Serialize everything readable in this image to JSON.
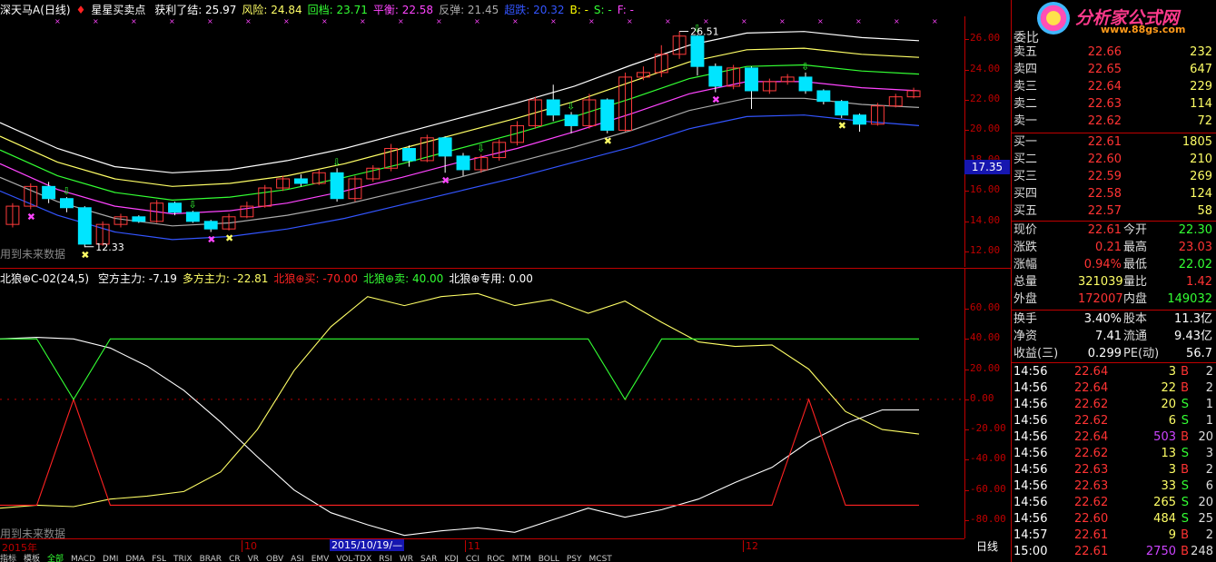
{
  "legend_top": {
    "name": "深天马A(日线)",
    "indicator": "星星买卖点",
    "items": [
      {
        "label": "获利了结: ",
        "value": "25.97",
        "color": "#ffffff"
      },
      {
        "label": "风险: ",
        "value": "24.84",
        "color": "#ffff66"
      },
      {
        "label": "回档: ",
        "value": "23.71",
        "color": "#33ff33"
      },
      {
        "label": "平衡: ",
        "value": "22.58",
        "color": "#ff44ff"
      },
      {
        "label": "反弹: ",
        "value": "21.45",
        "color": "#aaaaaa"
      },
      {
        "label": "超跌: ",
        "value": "20.32",
        "color": "#3355ff"
      },
      {
        "label": "B: ",
        "value": "-",
        "color": "#ffff00"
      },
      {
        "label": "S: ",
        "value": "-",
        "color": "#33ff33"
      },
      {
        "label": "F: ",
        "value": "-",
        "color": "#ff44ff"
      }
    ]
  },
  "legend_sub": {
    "name": "北狼⊕C-02(24,5)",
    "items": [
      {
        "label": "空方主力: ",
        "value": "-7.19",
        "color": "#ffffff"
      },
      {
        "label": "多方主力: ",
        "value": "-22.81",
        "color": "#ffff66"
      },
      {
        "label": "北狼⊕买: ",
        "value": "-70.00",
        "color": "#ff2222"
      },
      {
        "label": "北狼⊕卖: ",
        "value": "40.00",
        "color": "#33ff33"
      },
      {
        "label": "北狼⊕专用: ",
        "value": "0.00",
        "color": "#ffffff"
      }
    ]
  },
  "notes": {
    "future_top": "用到未来数据",
    "future_bottom": "用到未来数据"
  },
  "price_labels": {
    "high": "26.51",
    "low": "12.33"
  },
  "main_axis": {
    "ticks": [
      "26.00",
      "24.00",
      "22.00",
      "20.00",
      "18.00",
      "16.00",
      "14.00",
      "12.00"
    ],
    "current": "17.35"
  },
  "sub_axis": {
    "ticks": [
      "60.00",
      "40.00",
      "20.00",
      "0.00",
      "-20.00",
      "-40.00",
      "-60.00",
      "-80.00"
    ]
  },
  "date_axis": {
    "year": "2015年",
    "months": [
      "10",
      "11",
      "12"
    ],
    "cursor": "2015/10/19/—",
    "period": "日线"
  },
  "tabs": [
    "指标",
    "模板",
    "全部",
    "MACD",
    "DMI",
    "DMA",
    "FSL",
    "TRIX",
    "BRAR",
    "CR",
    "VR",
    "OBV",
    "ASI",
    "EMV",
    "VOL-TDX",
    "RSI",
    "WR",
    "SAR",
    "KDJ",
    "CCI",
    "ROC",
    "MTM",
    "BOLL",
    "PSY",
    "MCST"
  ],
  "logo": {
    "name": "分析家公式网",
    "url": "www.88gs.com"
  },
  "order_book": {
    "header": "委比",
    "sells": [
      {
        "label": "卖五",
        "price": "22.66",
        "vol": "232"
      },
      {
        "label": "卖四",
        "price": "22.65",
        "vol": "647"
      },
      {
        "label": "卖三",
        "price": "22.64",
        "vol": "229"
      },
      {
        "label": "卖二",
        "price": "22.63",
        "vol": "114"
      },
      {
        "label": "卖一",
        "price": "22.62",
        "vol": "72"
      }
    ],
    "buys": [
      {
        "label": "买一",
        "price": "22.61",
        "vol": "1805"
      },
      {
        "label": "买二",
        "price": "22.60",
        "vol": "210"
      },
      {
        "label": "买三",
        "price": "22.59",
        "vol": "269"
      },
      {
        "label": "买四",
        "price": "22.58",
        "vol": "124"
      },
      {
        "label": "买五",
        "price": "22.57",
        "vol": "58"
      }
    ]
  },
  "quote": [
    {
      "l1": "现价",
      "v1": "22.61",
      "c1": "#ff3333",
      "l2": "今开",
      "v2": "22.30",
      "c2": "#33ff33"
    },
    {
      "l1": "涨跌",
      "v1": "0.21",
      "c1": "#ff3333",
      "l2": "最高",
      "v2": "23.03",
      "c2": "#ff3333"
    },
    {
      "l1": "涨幅",
      "v1": "0.94%",
      "c1": "#ff3333",
      "l2": "最低",
      "v2": "22.02",
      "c2": "#33ff33"
    },
    {
      "l1": "总量",
      "v1": "321039",
      "c1": "#ffff66",
      "l2": "量比",
      "v2": "1.42",
      "c2": "#ff3333"
    },
    {
      "l1": "外盘",
      "v1": "172007",
      "c1": "#ff3333",
      "l2": "内盘",
      "v2": "149032",
      "c2": "#33ff33"
    }
  ],
  "stats": [
    {
      "l1": "换手",
      "v1": "3.40%",
      "l2": "股本",
      "v2": "11.3亿"
    },
    {
      "l1": "净资",
      "v1": "7.41",
      "l2": "流通",
      "v2": "9.43亿"
    },
    {
      "l1": "收益(三)",
      "v1": "0.299",
      "l2": "PE(动)",
      "v2": "56.7"
    }
  ],
  "ticks": [
    {
      "time": "14:56",
      "price": "22.64",
      "vol": "3",
      "bs": "B",
      "n": "2",
      "vc": "#ffff66"
    },
    {
      "time": "14:56",
      "price": "22.64",
      "vol": "22",
      "bs": "B",
      "n": "2",
      "vc": "#ffff66"
    },
    {
      "time": "14:56",
      "price": "22.62",
      "vol": "20",
      "bs": "S",
      "n": "1",
      "vc": "#ffff66"
    },
    {
      "time": "14:56",
      "price": "22.62",
      "vol": "6",
      "bs": "S",
      "n": "1",
      "vc": "#ffff66"
    },
    {
      "time": "14:56",
      "price": "22.64",
      "vol": "503",
      "bs": "B",
      "n": "20",
      "vc": "#cc44ff"
    },
    {
      "time": "14:56",
      "price": "22.62",
      "vol": "13",
      "bs": "S",
      "n": "3",
      "vc": "#ffff66"
    },
    {
      "time": "14:56",
      "price": "22.63",
      "vol": "3",
      "bs": "B",
      "n": "2",
      "vc": "#ffff66"
    },
    {
      "time": "14:56",
      "price": "22.63",
      "vol": "33",
      "bs": "S",
      "n": "6",
      "vc": "#ffff66"
    },
    {
      "time": "14:56",
      "price": "22.62",
      "vol": "265",
      "bs": "S",
      "n": "20",
      "vc": "#ffff66"
    },
    {
      "time": "14:56",
      "price": "22.60",
      "vol": "484",
      "bs": "S",
      "n": "25",
      "vc": "#ffff66"
    },
    {
      "time": "14:57",
      "price": "22.61",
      "vol": "9",
      "bs": "B",
      "n": "2",
      "vc": "#ffff66"
    },
    {
      "time": "15:00",
      "price": "22.61",
      "vol": "2750",
      "bs": "B",
      "n": "248",
      "vc": "#cc44ff"
    }
  ],
  "chart_data": [
    {
      "type": "line",
      "title": "星星买卖点",
      "ylim": [
        11,
        27.5
      ],
      "bands": [
        {
          "name": "获利了结",
          "color": "#ffffff",
          "values": [
            20.5,
            18.8,
            17.6,
            17.2,
            17.4,
            18.0,
            18.8,
            19.8,
            20.8,
            21.8,
            22.9,
            24.3,
            25.6,
            26.4,
            26.5,
            26.1,
            25.9
          ]
        },
        {
          "name": "风险",
          "color": "#ffff66",
          "values": [
            19.6,
            17.9,
            16.8,
            16.3,
            16.5,
            17.0,
            17.8,
            18.8,
            19.8,
            20.8,
            21.9,
            23.2,
            24.5,
            25.3,
            25.4,
            25.0,
            24.8
          ]
        },
        {
          "name": "回档",
          "color": "#33ff33",
          "values": [
            18.7,
            17.0,
            15.9,
            15.4,
            15.6,
            16.1,
            16.9,
            17.8,
            18.8,
            19.8,
            20.9,
            22.1,
            23.4,
            24.2,
            24.3,
            23.9,
            23.7
          ]
        },
        {
          "name": "平衡",
          "color": "#ff44ff",
          "values": [
            17.8,
            16.1,
            15.0,
            14.5,
            14.7,
            15.2,
            16.0,
            16.9,
            17.9,
            18.8,
            19.9,
            21.1,
            22.4,
            23.2,
            23.2,
            22.8,
            22.6
          ]
        },
        {
          "name": "反弹",
          "color": "#aaaaaa",
          "values": [
            16.9,
            15.3,
            14.2,
            13.7,
            13.9,
            14.4,
            15.1,
            16.0,
            16.9,
            17.9,
            18.9,
            20.0,
            21.3,
            22.1,
            22.1,
            21.7,
            21.5
          ]
        },
        {
          "name": "超跌",
          "color": "#3355ff",
          "values": [
            16.0,
            14.4,
            13.3,
            12.8,
            13.0,
            13.5,
            14.2,
            15.1,
            16.0,
            16.9,
            17.9,
            18.9,
            20.1,
            20.9,
            21.0,
            20.6,
            20.3
          ]
        }
      ],
      "candles": [
        [
          13.8,
          15.0,
          13.6,
          15.2
        ],
        [
          15.0,
          16.3,
          14.8,
          16.5
        ],
        [
          16.3,
          15.5,
          15.2,
          16.6
        ],
        [
          15.5,
          14.9,
          14.6,
          15.6
        ],
        [
          14.9,
          12.5,
          12.3,
          15.0
        ],
        [
          12.5,
          13.8,
          12.4,
          14.0
        ],
        [
          13.8,
          14.3,
          13.6,
          14.5
        ],
        [
          14.3,
          14.0,
          13.9,
          14.4
        ],
        [
          14.0,
          15.2,
          13.9,
          15.4
        ],
        [
          15.2,
          14.6,
          14.4,
          15.3
        ],
        [
          14.6,
          14.0,
          13.9,
          14.7
        ],
        [
          14.0,
          13.5,
          13.3,
          14.1
        ],
        [
          13.5,
          14.3,
          13.4,
          14.5
        ],
        [
          14.3,
          15.0,
          14.2,
          15.3
        ],
        [
          15.0,
          16.2,
          14.9,
          16.4
        ],
        [
          16.2,
          16.8,
          16.0,
          17.0
        ],
        [
          16.8,
          16.5,
          16.3,
          17.1
        ],
        [
          16.5,
          17.2,
          16.4,
          17.4
        ],
        [
          17.2,
          15.5,
          15.3,
          17.5
        ],
        [
          15.5,
          16.8,
          15.3,
          17.0
        ],
        [
          16.8,
          17.5,
          16.6,
          17.7
        ],
        [
          17.5,
          18.8,
          17.3,
          19.1
        ],
        [
          18.8,
          18.0,
          17.6,
          19.0
        ],
        [
          18.0,
          19.5,
          17.9,
          19.7
        ],
        [
          19.5,
          18.3,
          17.2,
          19.6
        ],
        [
          18.3,
          17.4,
          17.0,
          18.5
        ],
        [
          17.4,
          18.2,
          17.2,
          18.4
        ],
        [
          18.2,
          19.2,
          18.0,
          19.4
        ],
        [
          19.2,
          20.3,
          19.0,
          20.6
        ],
        [
          20.3,
          22.0,
          20.1,
          22.2
        ],
        [
          22.0,
          21.0,
          20.6,
          23.0
        ],
        [
          21.0,
          20.3,
          19.8,
          21.2
        ],
        [
          20.3,
          22.0,
          20.1,
          22.4
        ],
        [
          22.0,
          20.0,
          19.8,
          22.1
        ],
        [
          20.0,
          23.5,
          19.9,
          23.8
        ],
        [
          23.5,
          23.8,
          23.3,
          24.2
        ],
        [
          23.8,
          25.0,
          23.5,
          25.6
        ],
        [
          25.0,
          26.2,
          24.7,
          26.51
        ],
        [
          26.2,
          24.2,
          23.6,
          26.3
        ],
        [
          24.2,
          22.9,
          22.5,
          24.4
        ],
        [
          22.9,
          24.1,
          22.7,
          24.3
        ],
        [
          24.1,
          22.6,
          21.4,
          24.2
        ],
        [
          22.6,
          23.2,
          22.4,
          23.4
        ],
        [
          23.2,
          23.5,
          23.0,
          23.7
        ],
        [
          23.5,
          22.6,
          22.4,
          23.8
        ],
        [
          22.6,
          21.9,
          21.7,
          22.7
        ],
        [
          21.9,
          21.0,
          20.8,
          22.0
        ],
        [
          21.0,
          20.4,
          19.9,
          21.1
        ],
        [
          20.4,
          21.6,
          20.3,
          21.8
        ],
        [
          21.6,
          22.2,
          21.5,
          22.4
        ],
        [
          22.2,
          22.6,
          22.1,
          22.8
        ]
      ],
      "high_label": "26.51",
      "low_label": "12.33"
    },
    {
      "type": "line",
      "title": "北狼⊕C-02(24,5)",
      "ylim": [
        -92,
        75
      ],
      "series": [
        {
          "name": "空方主力",
          "color": "#ffffff",
          "values": [
            40,
            41,
            40,
            34,
            22,
            6,
            -15,
            -38,
            -60,
            -75,
            -83,
            -90,
            -87,
            -85,
            -88,
            -80,
            -72,
            -78,
            -73,
            -66,
            -55,
            -45,
            -28,
            -16,
            -7,
            -7
          ]
        },
        {
          "name": "多方主力",
          "color": "#ffff66",
          "values": [
            -72,
            -70,
            -71,
            -66,
            -64,
            -61,
            -48,
            -20,
            19,
            48,
            68,
            62,
            68,
            70,
            62,
            66,
            57,
            65,
            51,
            38,
            35,
            36,
            20,
            -8,
            -20,
            -23
          ]
        },
        {
          "name": "北狼⊕买",
          "color": "#ff2222",
          "values": [
            -70,
            -70,
            0,
            -70,
            -70,
            -70,
            -70,
            -70,
            -70,
            -70,
            -70,
            -70,
            -70,
            -70,
            -70,
            -70,
            -70,
            -70,
            -70,
            -70,
            -70,
            -70,
            0,
            -70,
            -70,
            -70
          ]
        },
        {
          "name": "北狼⊕卖",
          "color": "#33ff33",
          "values": [
            40,
            40,
            0,
            40,
            40,
            40,
            40,
            40,
            40,
            40,
            40,
            40,
            40,
            40,
            40,
            40,
            40,
            0,
            40,
            40,
            40,
            40,
            40,
            40,
            40,
            40
          ]
        }
      ]
    }
  ]
}
